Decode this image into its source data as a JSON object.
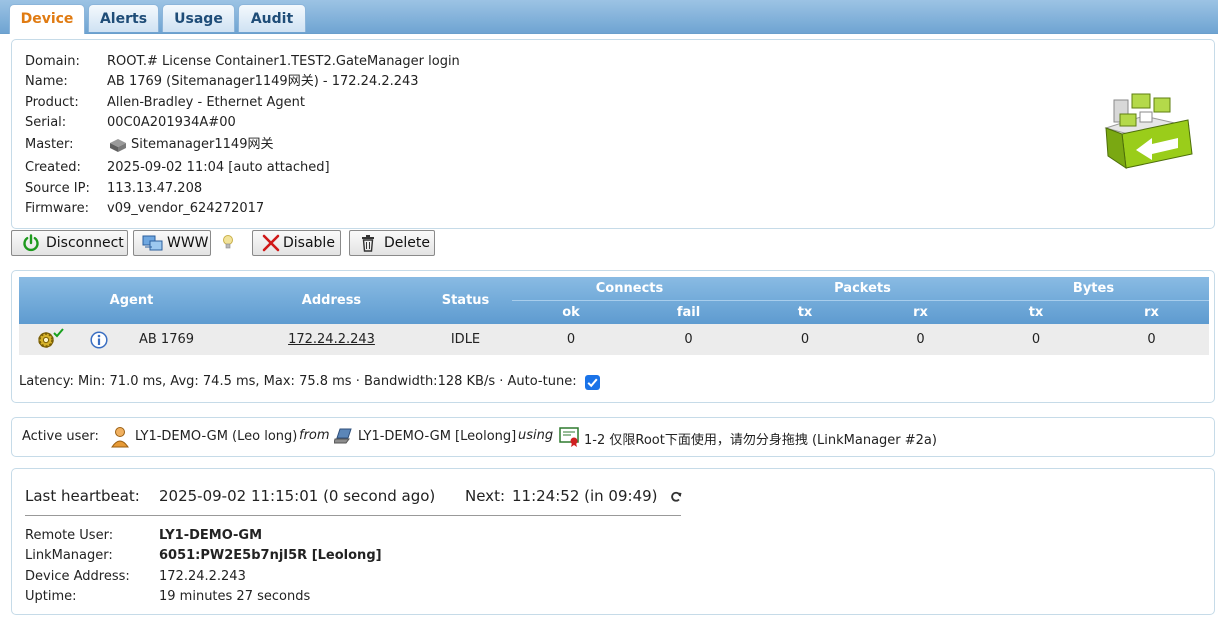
{
  "tabs": [
    {
      "label": "Device",
      "active": true
    },
    {
      "label": "Alerts",
      "active": false
    },
    {
      "label": "Usage",
      "active": false
    },
    {
      "label": "Audit",
      "active": false
    }
  ],
  "device": {
    "domain_label": "Domain:",
    "domain": "ROOT.# License Container1.TEST2.GateManager login",
    "name_label": "Name:",
    "name": "AB 1769 (Sitemanager1149网关) - 172.24.2.243",
    "product_label": "Product:",
    "product": "Allen-Bradley - Ethernet Agent",
    "serial_label": "Serial:",
    "serial": "00C0A201934A#00",
    "master_label": "Master:",
    "master": "Sitemanager1149网关",
    "created_label": "Created:",
    "created": "2025-09-02 11:04  [auto attached]",
    "source_ip_label": "Source IP:",
    "source_ip": "113.13.47.208",
    "firmware_label": "Firmware:",
    "firmware": "v09_vendor_624272017"
  },
  "actions": {
    "disconnect": "Disconnect",
    "www": "WWW",
    "disable": "Disable",
    "delete": "Delete"
  },
  "agent_table": {
    "headers": {
      "agent": "Agent",
      "address": "Address",
      "status": "Status",
      "connects": "Connects",
      "packets": "Packets",
      "bytes": "Bytes",
      "ok": "ok",
      "fail": "fail",
      "tx": "tx",
      "rx": "rx"
    },
    "row": {
      "agent": "AB 1769",
      "address": "172.24.2.243",
      "status": "IDLE",
      "connects_ok": "0",
      "connects_fail": "0",
      "packets_tx": "0",
      "packets_rx": "0",
      "bytes_tx": "0",
      "bytes_rx": "0"
    }
  },
  "latency_text": "Latency: Min: 71.0 ms, Avg: 74.5 ms, Max: 75.8 ms · Bandwidth:128 KB/s · Auto-tune:",
  "auto_tune": true,
  "active_user": {
    "label": "Active user:",
    "user": "LY1-DEMO-GM (Leo long)",
    "from": "from",
    "client": "LY1-DEMO-GM [Leolong]",
    "using": "using",
    "license": "1-2 仅限Root下面使用，请勿分身拖拽 (LinkManager #2a)"
  },
  "heartbeat": {
    "label": "Last heartbeat:",
    "last": "2025-09-02 11:15:01 (0 second ago)",
    "next_label": "Next:",
    "next": "11:24:52 (in 09:49)"
  },
  "session": {
    "remote_user_label": "Remote User:",
    "remote_user": "LY1-DEMO-GM",
    "linkmanager_label": "LinkManager:",
    "linkmanager": "6051:PW2E5b7njI5R [Leolong]",
    "device_address_label": "Device Address:",
    "device_address": "172.24.2.243",
    "uptime_label": "Uptime:",
    "uptime": "19 minutes 27 seconds"
  },
  "colors": {
    "accent_tab": "#e07b12",
    "header_blue": "#5e9bd0",
    "device_green": "#9acd1a"
  }
}
